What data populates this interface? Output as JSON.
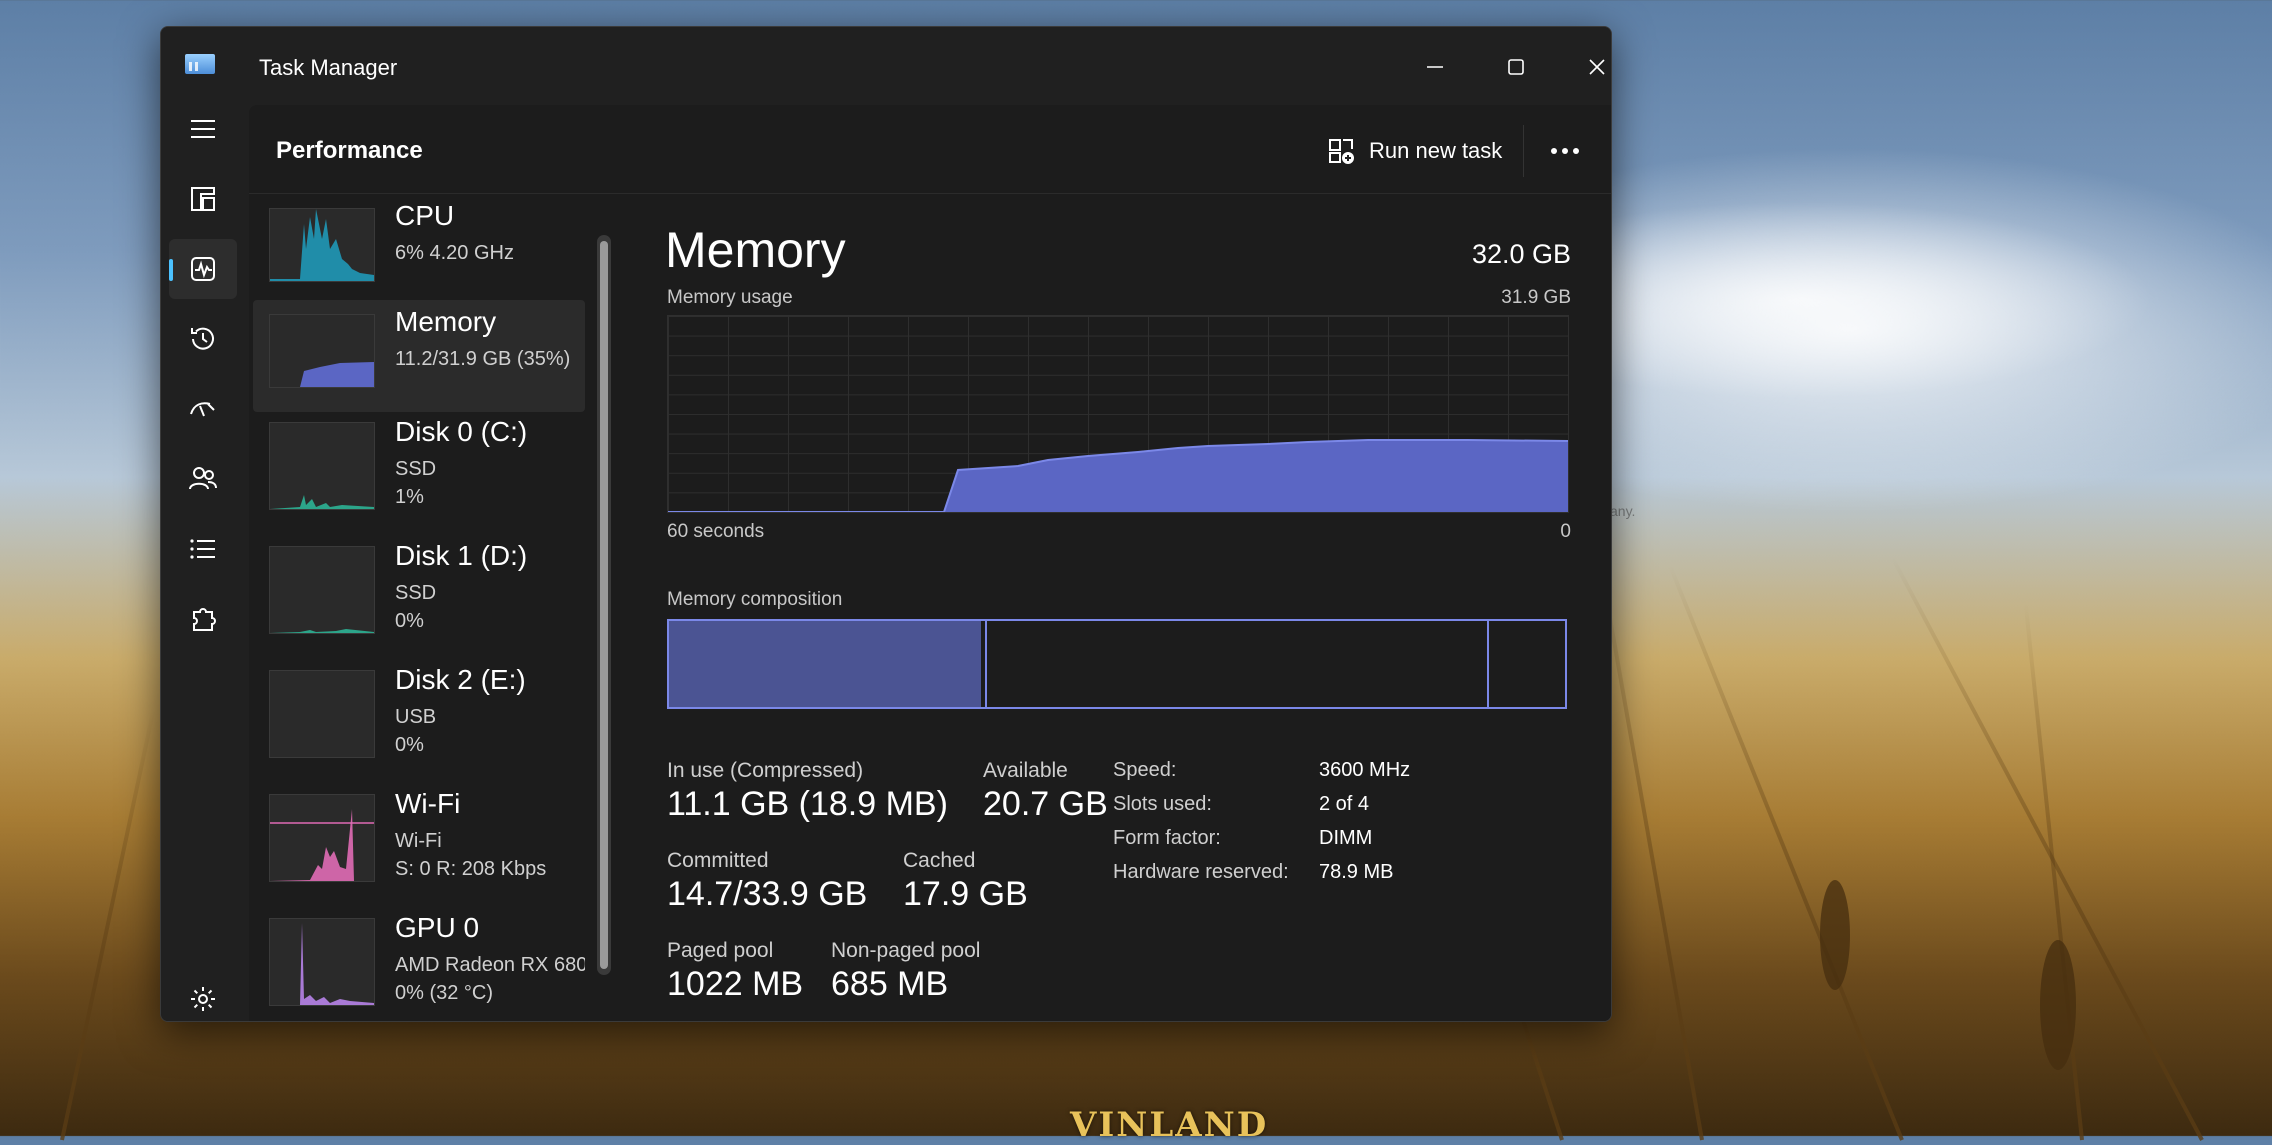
{
  "window": {
    "title": "Task Manager"
  },
  "header": {
    "page_title": "Performance",
    "run_new_task": "Run new task"
  },
  "nav": [
    {
      "icon": "hamburger-menu-icon"
    },
    {
      "icon": "processes-icon"
    },
    {
      "icon": "performance-icon",
      "active": true
    },
    {
      "icon": "app-history-icon"
    },
    {
      "icon": "startup-apps-icon"
    },
    {
      "icon": "users-icon"
    },
    {
      "icon": "details-icon"
    },
    {
      "icon": "services-icon"
    },
    {
      "icon": "settings-icon"
    }
  ],
  "devices": [
    {
      "name": "CPU",
      "line1": "6%  4.20 GHz",
      "line2": ""
    },
    {
      "name": "Memory",
      "line1": "11.2/31.9 GB (35%)",
      "line2": ""
    },
    {
      "name": "Disk 0 (C:)",
      "line1": "SSD",
      "line2": "1%"
    },
    {
      "name": "Disk 1 (D:)",
      "line1": "SSD",
      "line2": "0%"
    },
    {
      "name": "Disk 2 (E:)",
      "line1": "USB",
      "line2": "0%"
    },
    {
      "name": "Wi-Fi",
      "line1": "Wi-Fi",
      "line2": "S: 0  R: 208 Kbps"
    },
    {
      "name": "GPU 0",
      "line1": "AMD Radeon RX 680",
      "line2": "0%  (32 °C)"
    }
  ],
  "memory": {
    "title": "Memory",
    "total": "32.0 GB",
    "usage_label": "Memory usage",
    "usage_max": "31.9 GB",
    "time_left": "60 seconds",
    "time_right": "0",
    "composition_label": "Memory composition",
    "in_use_label": "In use (Compressed)",
    "in_use_value": "11.1 GB (18.9 MB)",
    "available_label": "Available",
    "available_value": "20.7 GB",
    "committed_label": "Committed",
    "committed_value": "14.7/33.9 GB",
    "cached_label": "Cached",
    "cached_value": "17.9 GB",
    "paged_label": "Paged pool",
    "paged_value": "1022 MB",
    "nonpaged_label": "Non-paged pool",
    "nonpaged_value": "685 MB",
    "speed_label": "Speed:",
    "speed_value": "3600 MHz",
    "slots_label": "Slots used:",
    "slots_value": "2 of 4",
    "form_label": "Form factor:",
    "form_value": "DIMM",
    "hwres_label": "Hardware reserved:",
    "hwres_value": "78.9 MB"
  },
  "colors": {
    "memory_fill": "#5b66c4",
    "memory_line": "#7b88e8",
    "cpu": "#1f9fc0",
    "disk": "#2ca58a",
    "wifi": "#e06bb5",
    "gpu": "#a97ad6",
    "accent": "#4cc2ff"
  },
  "background": {
    "watermark": "any.",
    "logo_text": "VINLAND"
  }
}
